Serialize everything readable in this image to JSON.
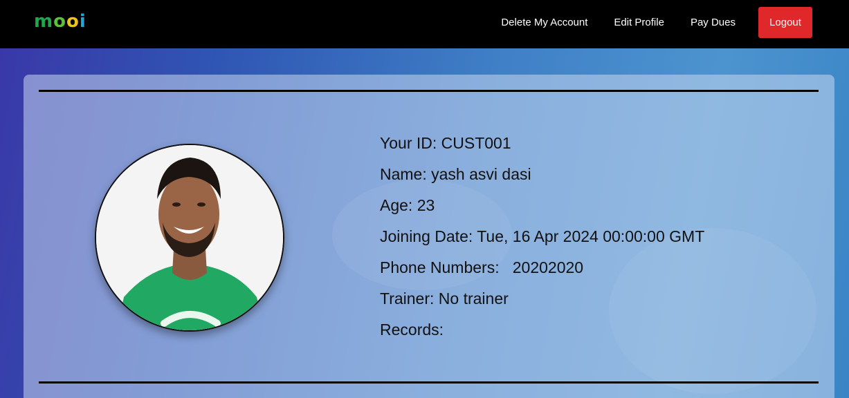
{
  "navbar": {
    "logo": {
      "m": "m",
      "o1": "o",
      "o2": "o",
      "i": "i"
    },
    "links": {
      "delete_account": "Delete My Account",
      "edit_profile": "Edit Profile",
      "pay_dues": "Pay Dues"
    },
    "logout_label": "Logout",
    "colors": {
      "logout_bg": "#e0282a",
      "background": "#000000"
    }
  },
  "profile": {
    "avatar_icon": "user-photo",
    "rows": [
      "Your ID: CUST001",
      "Name: yash asvi dasi",
      "Age: 23",
      "Joining Date: Tue, 16 Apr 2024 00:00:00 GMT",
      "Phone Numbers:   20202020",
      "Trainer: No trainer",
      "Records:"
    ]
  }
}
